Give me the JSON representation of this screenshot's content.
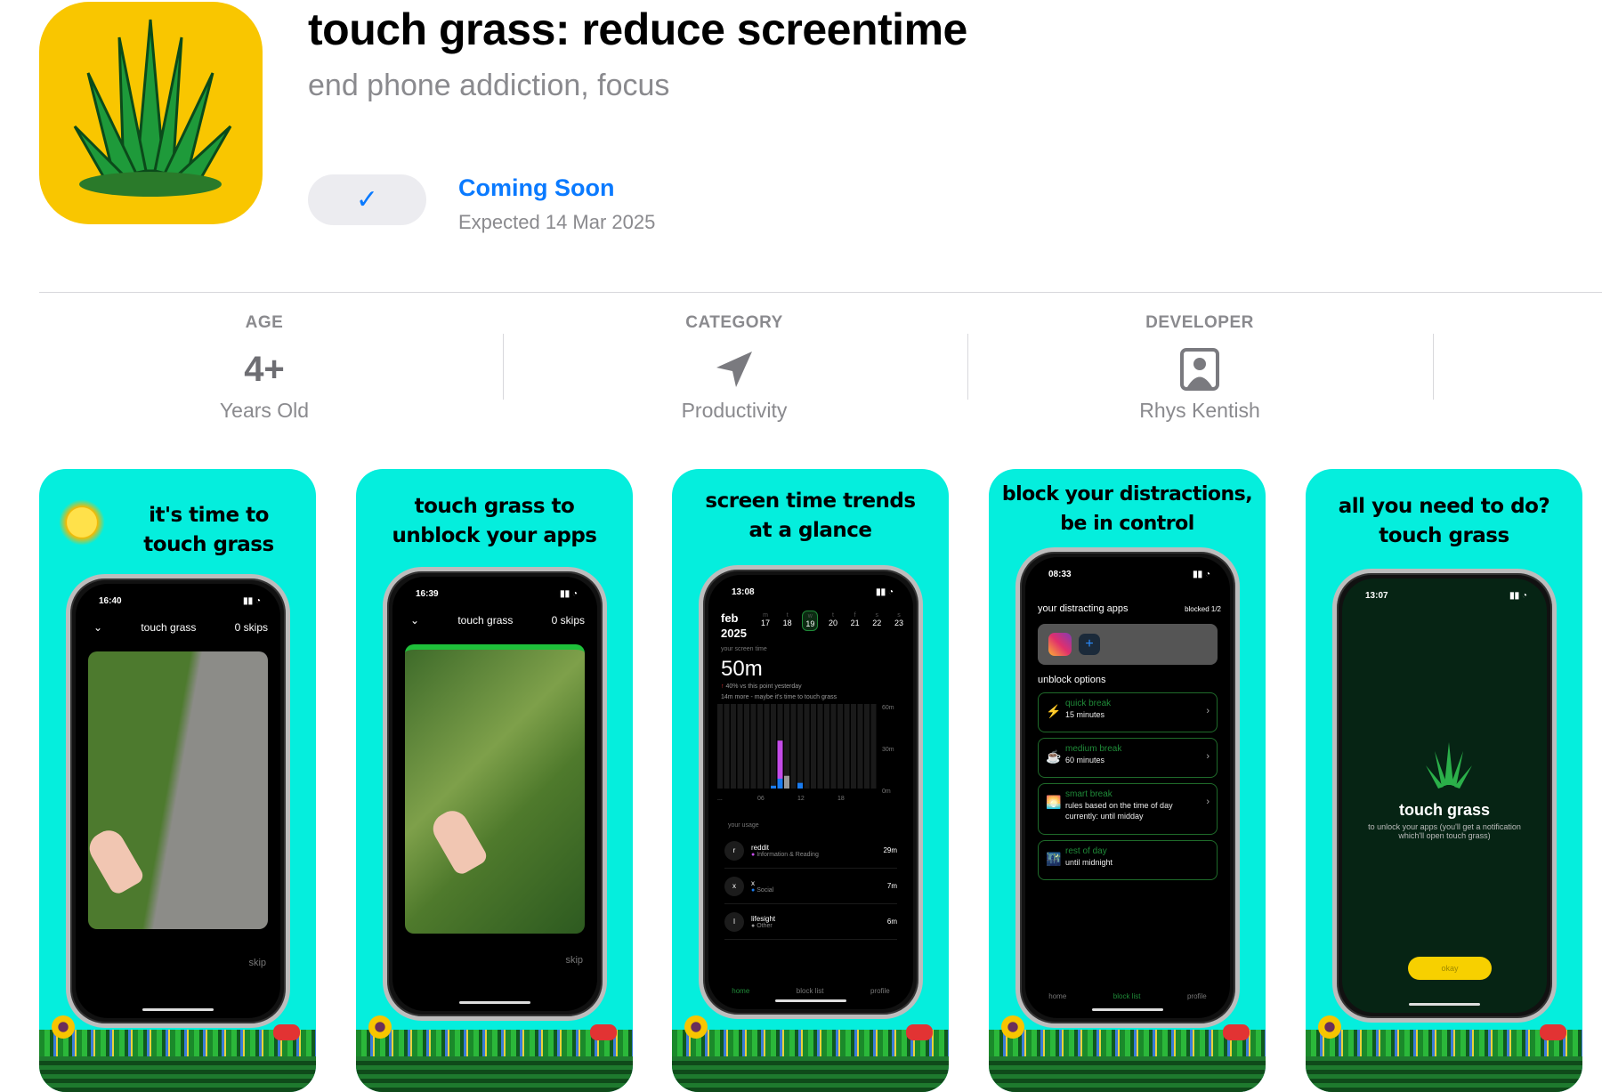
{
  "header": {
    "title": "touch grass: reduce screentime",
    "subtitle": "end phone addiction, focus",
    "button_icon": "checkmark-icon",
    "button_glyph": "✓",
    "status": "Coming Soon",
    "expected": "Expected 14 Mar 2025",
    "accent": "#0a7aff"
  },
  "info": [
    {
      "caption": "AGE",
      "value": "4+",
      "detail": "Years Old"
    },
    {
      "caption": "CATEGORY",
      "icon": "paper-plane-icon",
      "detail": "Productivity"
    },
    {
      "caption": "DEVELOPER",
      "icon": "person-badge-icon",
      "detail": "Rhys Kentish"
    }
  ],
  "screenshots": [
    {
      "caption1": "it's time to",
      "caption2": "touch grass",
      "time": "16:40",
      "header": "touch grass",
      "skips": "0 skips",
      "skip": "skip"
    },
    {
      "caption1": "touch grass to",
      "caption2": "unblock your apps",
      "time": "16:39",
      "header": "touch grass",
      "skips": "0 skips",
      "skip": "skip"
    },
    {
      "caption1": "screen time trends",
      "caption2": "at a glance",
      "time": "13:08",
      "month": "feb",
      "year": "2025",
      "days": [
        {
          "d": "m",
          "n": "17"
        },
        {
          "d": "t",
          "n": "18"
        },
        {
          "d": "w",
          "n": "19"
        },
        {
          "d": "t",
          "n": "20"
        },
        {
          "d": "f",
          "n": "21"
        },
        {
          "d": "s",
          "n": "22"
        },
        {
          "d": "s",
          "n": "23"
        }
      ],
      "screen_time_label": "your screen time",
      "total": "50m",
      "change": "40% vs this point yesterday",
      "hint": "14m more - maybe it's time to touch grass",
      "y_ticks": [
        "60m",
        "30m",
        "0m"
      ],
      "x_ticks": [
        "...",
        "06",
        "12",
        "18"
      ],
      "usage_label": "your usage",
      "usage": [
        {
          "letter": "r",
          "name": "reddit",
          "category": "Information & Reading",
          "time": "29m",
          "color": "#c44be8"
        },
        {
          "letter": "x",
          "name": "x",
          "category": "Social",
          "time": "7m",
          "color": "#1a7cf0"
        },
        {
          "letter": "l",
          "name": "lifesight",
          "category": "Other",
          "time": "6m",
          "color": "#999999"
        }
      ],
      "tabs": [
        "home",
        "block list",
        "profile"
      ]
    },
    {
      "caption1": "block your distractions,",
      "caption2": "be in control",
      "time": "08:33",
      "apps_label": "your distracting apps",
      "blocked": "blocked 1/2",
      "unblock_label": "unblock options",
      "options": [
        {
          "icon": "⚡",
          "title": "quick break",
          "sub": "15 minutes"
        },
        {
          "icon": "☕",
          "title": "medium break",
          "sub": "60 minutes"
        },
        {
          "icon": "🌅",
          "title": "smart break",
          "sub": "rules based on the time of day",
          "sub2": "currently: until midday"
        },
        {
          "icon": "🌃",
          "title": "rest of day",
          "sub": "until midnight"
        }
      ],
      "tabs": [
        "home",
        "block list",
        "profile"
      ]
    },
    {
      "caption1": "all you need to do?",
      "caption2": "touch grass",
      "time": "13:07",
      "title": "touch grass",
      "body": "to unlock your apps (you'll get a notification which'll open touch grass)",
      "okay": "okay"
    }
  ]
}
